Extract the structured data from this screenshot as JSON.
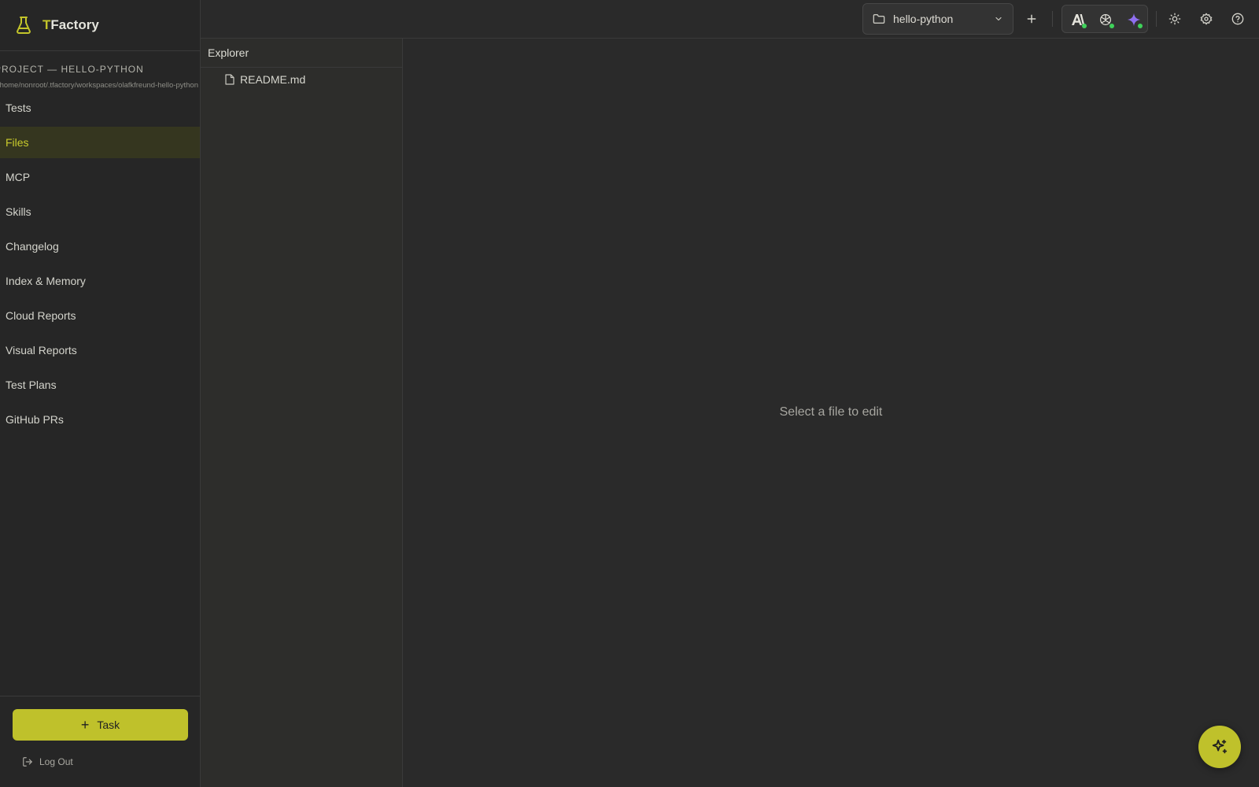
{
  "app": {
    "brand_first_letter": "T",
    "brand_rest": "Factory",
    "accent_color": "#bfc12b"
  },
  "sidebar": {
    "project_title": "PROJECT — HELLO-PYTHON",
    "project_path": "/home/nonroot/.tfactory/workspaces/olafkfreund-hello-python",
    "items": [
      {
        "label": "Tests",
        "active": false
      },
      {
        "label": "Files",
        "active": true
      },
      {
        "label": "MCP",
        "active": false
      },
      {
        "label": "Skills",
        "active": false
      },
      {
        "label": "Changelog",
        "active": false
      },
      {
        "label": "Index & Memory",
        "active": false
      },
      {
        "label": "Cloud Reports",
        "active": false
      },
      {
        "label": "Visual Reports",
        "active": false
      },
      {
        "label": "Test Plans",
        "active": false
      },
      {
        "label": "GitHub PRs",
        "active": false
      }
    ],
    "task_button_label": "Task",
    "logout_label": "Log Out"
  },
  "topbar": {
    "project_select_value": "hello-python",
    "icons": [
      "folder-icon",
      "chevron-down-icon",
      "plus-icon",
      "anthropic-icon",
      "openai-icon",
      "gemini-icon",
      "sun-icon",
      "gear-icon",
      "help-icon"
    ]
  },
  "explorer": {
    "header": "Explorer",
    "files": [
      {
        "name": "README.md",
        "icon": "file-icon"
      }
    ]
  },
  "editor": {
    "empty_message": "Select a file to edit"
  }
}
